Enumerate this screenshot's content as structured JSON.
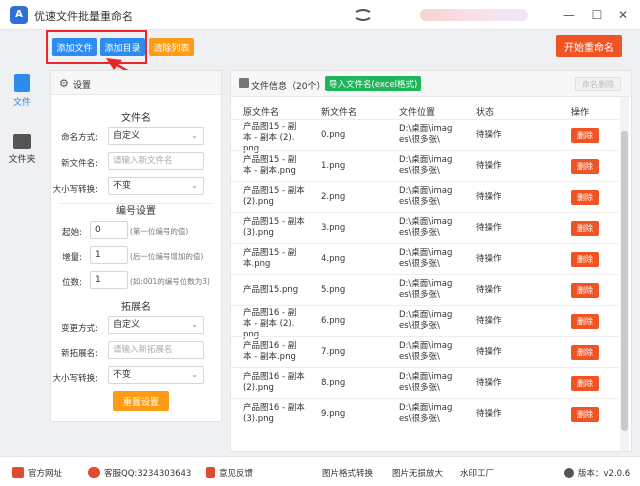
{
  "app": {
    "logo": "A",
    "title": "优速文件批量重命名"
  },
  "titlebar": {
    "minimize": "—",
    "maximize": "☐",
    "close": "✕"
  },
  "toolbar": {
    "add_files": "添加文件",
    "add_dir": "添加目录",
    "clear_list": "清除列表",
    "start": "开始重命名"
  },
  "nav": {
    "files": "文件",
    "folders": "文件夹"
  },
  "settings": {
    "title": "设置",
    "sec_filename": "文件名",
    "naming_mode_label": "命名方式:",
    "naming_mode_value": "自定义",
    "new_name_label": "新文件名:",
    "new_name_placeholder": "请输入新文件名",
    "case_label": "大小写转换:",
    "case_value": "不变",
    "sec_number": "编号设置",
    "start_label": "起始:",
    "start_value": "0",
    "start_hint": "(第一位编号的值)",
    "step_label": "增量:",
    "step_value": "1",
    "step_hint": "(后一位编号增加的值)",
    "digits_label": "位数:",
    "digits_value": "1",
    "digits_hint": "(如:001的编号位数为3)",
    "sec_ext": "拓展名",
    "ext_mode_label": "变更方式:",
    "ext_mode_value": "自定义",
    "new_ext_label": "新拓展名:",
    "new_ext_placeholder": "请输入新拓展名",
    "ext_case_label": "大小写转换:",
    "ext_case_value": "不变",
    "reset": "重置设置"
  },
  "filelist": {
    "title": "文件信息（20个）",
    "import": "导入文件名(excel格式)",
    "clear_names": "命名删除",
    "headers": {
      "orig": "原文件名",
      "new": "新文件名",
      "loc": "文件位置",
      "status": "状态",
      "op": "操作"
    },
    "rows": [
      {
        "orig": [
          "产品图15 - 副",
          "本 - 副本 (2).",
          "png"
        ],
        "new": "0.png",
        "loc": [
          "D:\\桌面\\imag",
          "es\\很多张\\"
        ],
        "status": "待操作",
        "op": "删除"
      },
      {
        "orig": [
          "产品图15 - 副",
          "本 - 副本.png"
        ],
        "new": "1.png",
        "loc": [
          "D:\\桌面\\imag",
          "es\\很多张\\"
        ],
        "status": "待操作",
        "op": "删除"
      },
      {
        "orig": [
          "产品图15 - 副本",
          "(2).png"
        ],
        "new": "2.png",
        "loc": [
          "D:\\桌面\\imag",
          "es\\很多张\\"
        ],
        "status": "待操作",
        "op": "删除"
      },
      {
        "orig": [
          "产品图15 - 副本",
          "(3).png"
        ],
        "new": "3.png",
        "loc": [
          "D:\\桌面\\imag",
          "es\\很多张\\"
        ],
        "status": "待操作",
        "op": "删除"
      },
      {
        "orig": [
          "产品图15 - 副",
          "本.png"
        ],
        "new": "4.png",
        "loc": [
          "D:\\桌面\\imag",
          "es\\很多张\\"
        ],
        "status": "待操作",
        "op": "删除"
      },
      {
        "orig": [
          "产品图15.png"
        ],
        "new": "5.png",
        "loc": [
          "D:\\桌面\\imag",
          "es\\很多张\\"
        ],
        "status": "待操作",
        "op": "删除"
      },
      {
        "orig": [
          "产品图16 - 副",
          "本 - 副本 (2).",
          "png"
        ],
        "new": "6.png",
        "loc": [
          "D:\\桌面\\imag",
          "es\\很多张\\"
        ],
        "status": "待操作",
        "op": "删除"
      },
      {
        "orig": [
          "产品图16 - 副",
          "本 - 副本.png"
        ],
        "new": "7.png",
        "loc": [
          "D:\\桌面\\imag",
          "es\\很多张\\"
        ],
        "status": "待操作",
        "op": "删除"
      },
      {
        "orig": [
          "产品图16 - 副本",
          "(2).png"
        ],
        "new": "8.png",
        "loc": [
          "D:\\桌面\\imag",
          "es\\很多张\\"
        ],
        "status": "待操作",
        "op": "删除"
      },
      {
        "orig": [
          "产品图16 - 副本",
          "(3).png"
        ],
        "new": "9.png",
        "loc": [
          "D:\\桌面\\imag",
          "es\\很多张\\"
        ],
        "status": "待操作",
        "op": "删除"
      }
    ]
  },
  "footer": {
    "website": "官方网址",
    "service": "客服QQ:3234303643",
    "feedback": "意见反馈",
    "img_convert": "图片格式转换",
    "img_zoom": "图片无损放大",
    "watermark": "水印工厂",
    "version": "版本：v2.0.6"
  },
  "colors": {
    "accent_blue": "#2d8cf0",
    "orange": "#ff9c16",
    "danger": "#f05424",
    "green": "#1fb55b",
    "highlight": "#e8262b"
  },
  "icons": [
    "app-logo-icon",
    "file-icon",
    "folder-icon",
    "gear-icon",
    "list-icon",
    "website-icon",
    "qq-icon",
    "pdf-icon",
    "info-icon"
  ]
}
